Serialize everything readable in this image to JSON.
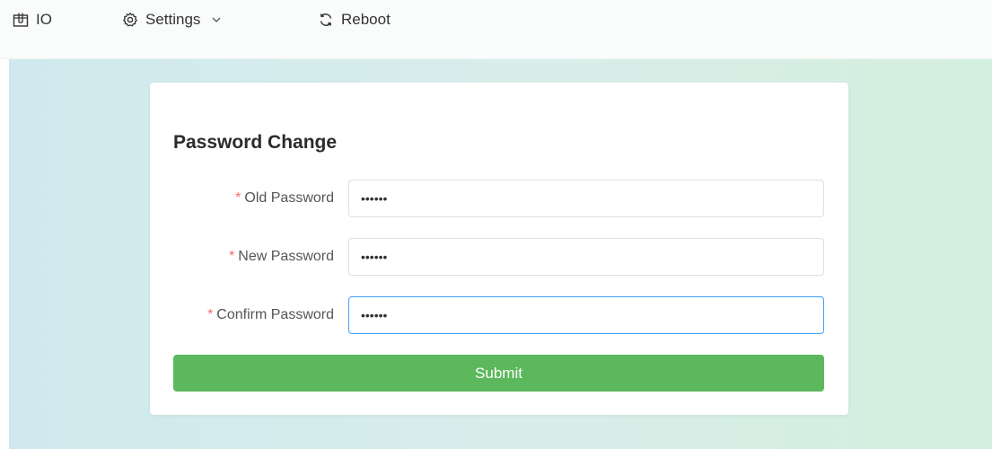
{
  "nav": {
    "items": [
      {
        "label": "IO",
        "icon": "io-port-icon"
      },
      {
        "label": "Settings",
        "icon": "gear-icon",
        "has_dropdown": true
      },
      {
        "label": "Reboot",
        "icon": "refresh-icon"
      }
    ]
  },
  "form": {
    "title": "Password Change",
    "required_marker": "*",
    "fields": [
      {
        "label": "Old Password",
        "value": "abcdef",
        "focused": false
      },
      {
        "label": "New Password",
        "value": "abcdef",
        "focused": false
      },
      {
        "label": "Confirm Password",
        "value": "abcdef",
        "focused": true
      }
    ],
    "submit_label": "Submit"
  },
  "colors": {
    "accent_green": "#5cb85c",
    "required_red": "#f56c6c",
    "focus_blue": "#409eff"
  }
}
